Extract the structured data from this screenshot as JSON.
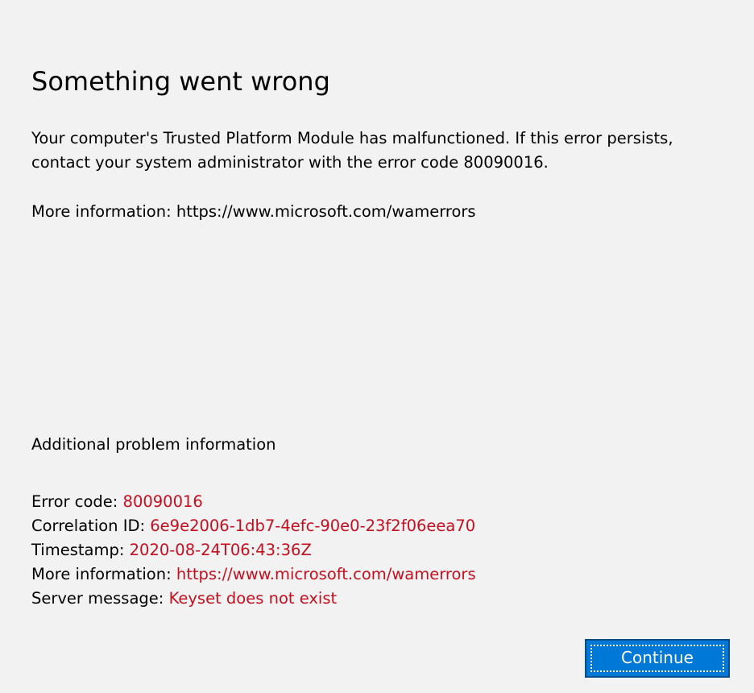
{
  "title": "Something went wrong",
  "message": "Your computer's Trusted Platform Module has malfunctioned. If this error persists, contact your system administrator with the error code 80090016.",
  "more_info_line": "More information: https://www.microsoft.com/wamerrors",
  "additional": {
    "heading": "Additional problem information",
    "rows": [
      {
        "label": "Error code: ",
        "value": "80090016"
      },
      {
        "label": "Correlation ID: ",
        "value": "6e9e2006-1db7-4efc-90e0-23f2f06eea70"
      },
      {
        "label": "Timestamp: ",
        "value": "2020-08-24T06:43:36Z"
      },
      {
        "label": "More information: ",
        "value": "https://www.microsoft.com/wamerrors"
      },
      {
        "label": "Server message: ",
        "value": "Keyset does not exist"
      }
    ]
  },
  "buttons": {
    "continue_label": "Continue"
  },
  "colors": {
    "background": "#f2f2f2",
    "detail_value": "#c50f1f",
    "button_bg": "#0078d7",
    "button_border": "#004e8c"
  }
}
